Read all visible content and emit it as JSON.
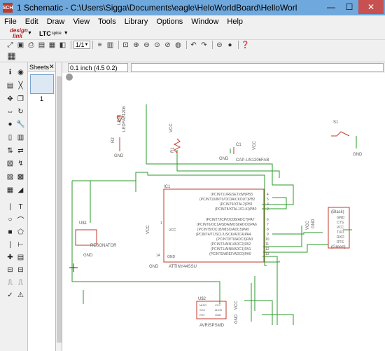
{
  "window": {
    "app_icon": "SCH",
    "title": "1 Schematic - C:\\Users\\Sigga\\Documents\\eagle\\HeloWorldBoard\\HelloWorldSchematic.s",
    "min_glyph": "—",
    "max_glyph": "☐",
    "close_glyph": "✕"
  },
  "menu": [
    "File",
    "Edit",
    "Draw",
    "View",
    "Tools",
    "Library",
    "Options",
    "Window",
    "Help"
  ],
  "toolbar": {
    "design_link": "design link",
    "ltc_label": "LTC",
    "ltc_sub": "spice",
    "page_value": "1/1"
  },
  "sheets": {
    "header": "Sheets",
    "sheet_number": "1"
  },
  "command": {
    "coordinate": "0.1 inch (4.5 0.2)",
    "input_value": ""
  },
  "schematic": {
    "led_labels": [
      "LED1",
      "LEDFAB1206"
    ],
    "r2_label": "R2",
    "gnd": "GND",
    "vcc": "VCC",
    "r1_label": "R1",
    "c1_label": "C1",
    "cap_label": "CAP-US1206FAB",
    "s1_label": "S1",
    "ic1_label": "IC1",
    "ic_part": "ATTINY44SSU",
    "ic_pins_left": [
      "(PCINT11/RESET/dW)PB3",
      "(PCINT10/INT0/OC0A/CKOUT)PB2",
      "(PCINT9/XTAL2)PB1",
      "(PCINT8/XTAL1/CLKI)PB0"
    ],
    "ic_pins_right": [
      "(PCINT7/ICP/OC0B/ADC7)PA7",
      "(PCINT6/OC1A/SDA/MOSI/ADC6)PA6",
      "(PCINT5/OC1B/MISO/ADC5)PA5",
      "(PCINT4/T1/SCL/USCK/ADC4)PA4",
      "(PCINT3/T0/ADC3)PA3",
      "(PCINT2/AIN1/ADC2)PA2",
      "(PCINT1/AIN0/ADC1)PA1",
      "(PCINT0/AREF/ADC0)PA0"
    ],
    "pin_nums_a": [
      "4",
      "5",
      "3",
      "2"
    ],
    "pin_nums_b": [
      "6",
      "7",
      "8",
      "9",
      "10",
      "11",
      "12",
      "13"
    ],
    "ic_vcc": "VCC",
    "ic_gnd": "GND",
    "pin1": "1",
    "pin14": "14",
    "u1_label": "U$1",
    "resonator": "RESONATOR",
    "ftdi_title": "(Black)",
    "ftdi_pins": [
      "GND",
      "CTS",
      "VCC",
      "TXD",
      "RXD",
      "RTS"
    ],
    "ftdi_footer": "(Green)",
    "u2_label": "U$2",
    "avrisp": "AVRISPSMD",
    "isp_pins": [
      "MISO",
      "SCK",
      "RST",
      "VCC",
      "MOSI",
      "GND"
    ]
  }
}
